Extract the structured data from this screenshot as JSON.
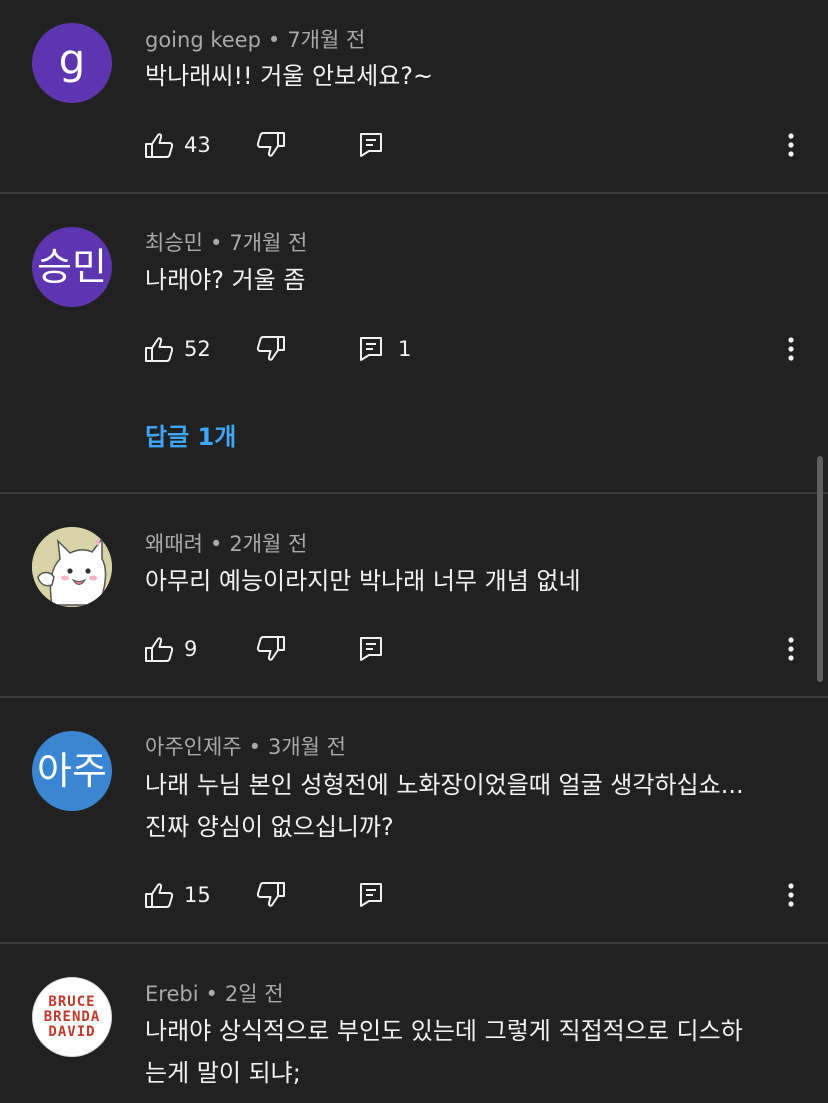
{
  "comments": [
    {
      "avatar_text": "g",
      "author": "going keep",
      "time": "7개월 전",
      "text": "박나래씨!! 거울 안보세요?~",
      "likes": "43",
      "replies_count": ""
    },
    {
      "avatar_text": "승민",
      "author": "최승민",
      "time": "7개월 전",
      "text": "나래야? 거울 좀",
      "likes": "52",
      "replies_count": "1",
      "replies_link": "답글 1개"
    },
    {
      "avatar_text": "",
      "author": "왜때려",
      "time": "2개월 전",
      "text": "아무리 예능이라지만 박나래 너무 개념 없네",
      "likes": "9",
      "replies_count": ""
    },
    {
      "avatar_text": "아주",
      "author": "아주인제주",
      "time": "3개월 전",
      "text_lines": [
        "나래 누님 본인 성형전에 노화장이었을때 얼굴 생각하십쇼...",
        "진짜 양심이 없으십니까?"
      ],
      "likes": "15",
      "replies_count": ""
    },
    {
      "avatar_lines": [
        "BRUCE",
        "BRENDA",
        "DAVID"
      ],
      "author": "Erebi",
      "time": "2일 전",
      "text_lines": [
        "나래야 상식적으로 부인도 있는데 그렇게 직접적으로 디스하",
        "는게 말이 되냐;"
      ]
    }
  ],
  "colors": {
    "background": "#212121",
    "link": "#3ea6ff",
    "avatar_purple": "#5e35b1",
    "avatar_blue": "#3a86d3"
  },
  "icons": [
    "like-icon",
    "dislike-icon",
    "reply-icon",
    "more-vert-icon",
    "cat-avatar"
  ],
  "separator": "•"
}
